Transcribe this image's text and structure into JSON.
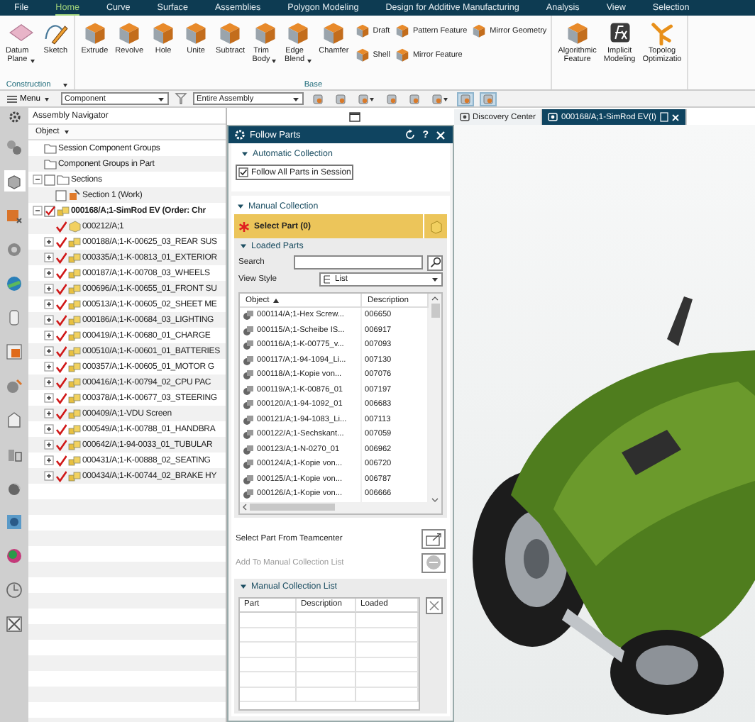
{
  "menu_bar": [
    {
      "label": "File",
      "selected": false
    },
    {
      "label": "Home",
      "selected": true
    },
    {
      "label": "Curve",
      "selected": false
    },
    {
      "label": "Surface",
      "selected": false
    },
    {
      "label": "Assemblies",
      "selected": false
    },
    {
      "label": "Polygon Modeling",
      "selected": false
    },
    {
      "label": "Design for Additive Manufacturing",
      "selected": false
    },
    {
      "label": "Analysis",
      "selected": false
    },
    {
      "label": "View",
      "selected": false
    },
    {
      "label": "Selection",
      "selected": false
    }
  ],
  "ribbon": {
    "groups": [
      {
        "label": "Construction",
        "has_menu": true,
        "items": [
          {
            "kind": "button",
            "label": "Datum\nPlane",
            "dropdown": true
          },
          {
            "kind": "button",
            "label": "Sketch",
            "dropdown": false
          }
        ]
      },
      {
        "label": "Base",
        "has_menu": false,
        "items": [
          {
            "kind": "button",
            "label": "Extrude",
            "dropdown": false
          },
          {
            "kind": "button",
            "label": "Revolve",
            "dropdown": false
          },
          {
            "kind": "button",
            "label": "Hole",
            "dropdown": false
          },
          {
            "kind": "button",
            "label": "Unite",
            "dropdown": false
          },
          {
            "kind": "button",
            "label": "Subtract",
            "dropdown": false
          },
          {
            "kind": "button",
            "label": "Trim\nBody",
            "dropdown": true
          },
          {
            "kind": "button",
            "label": "Edge\nBlend",
            "dropdown": true
          },
          {
            "kind": "button",
            "label": "Chamfer",
            "dropdown": false
          },
          {
            "kind": "stack",
            "items": [
              {
                "label": "Draft"
              },
              {
                "label": "Shell"
              }
            ]
          },
          {
            "kind": "stack",
            "items": [
              {
                "label": "Pattern Feature"
              },
              {
                "label": "Mirror Feature"
              }
            ]
          },
          {
            "kind": "stack",
            "items": [
              {
                "label": "Mirror Geometry"
              }
            ]
          }
        ]
      },
      {
        "has_menu": false,
        "items": [
          {
            "kind": "button",
            "label": "Algorithmic\nFeature",
            "dropdown": false
          },
          {
            "kind": "button",
            "label": "Implicit\nModeling",
            "dropdown": false
          },
          {
            "kind": "button",
            "label": "Topolog\nOptimizatio",
            "dropdown": false
          }
        ]
      }
    ]
  },
  "toolbar": {
    "menu": "Menu",
    "selection_filter": "Component",
    "scope": "Entire Assembly",
    "tools": [
      {
        "pressed": false,
        "dropdown": false
      },
      {
        "pressed": false,
        "dropdown": false
      },
      {
        "pressed": false,
        "dropdown": true
      },
      {
        "pressed": false,
        "dropdown": false
      },
      {
        "pressed": false,
        "dropdown": false
      },
      {
        "pressed": false,
        "dropdown": true
      },
      {
        "pressed": true,
        "dropdown": false
      },
      {
        "pressed": true,
        "dropdown": false
      }
    ]
  },
  "side_strip": [
    {
      "selected": false
    },
    {
      "selected": true
    },
    {
      "selected": false
    },
    {
      "selected": false
    },
    {
      "selected": false
    },
    {
      "selected": false
    },
    {
      "selected": false
    },
    {
      "selected": false
    },
    {
      "selected": false
    },
    {
      "selected": false
    },
    {
      "selected": false
    },
    {
      "selected": false
    },
    {
      "selected": false
    },
    {
      "selected": false
    },
    {
      "selected": false
    }
  ],
  "navigator": {
    "title": "Assembly Navigator",
    "column": "Object",
    "tree": [
      {
        "kind": "folder",
        "label": "Session Component Groups"
      },
      {
        "kind": "folder",
        "label": "Component Groups in Part"
      },
      {
        "kind": "folder",
        "label": "Sections",
        "expanded": true,
        "checked": false,
        "children": [
          {
            "kind": "section",
            "label": "Section 1 (Work)",
            "checked": false
          }
        ]
      },
      {
        "kind": "root",
        "label": "000168/A;1-SimRod EV (Order: Chr",
        "expanded": true,
        "checked": true,
        "children": [
          {
            "kind": "part",
            "label": "000212/A;1",
            "checked": true
          },
          {
            "kind": "assembly",
            "label": "000188/A;1-K-00625_03_REAR SUS",
            "expanded": false,
            "checked": true
          },
          {
            "kind": "assembly",
            "label": "000335/A;1-K-00813_01_EXTERIOR",
            "expanded": false,
            "checked": true
          },
          {
            "kind": "assembly",
            "label": "000187/A;1-K-00708_03_WHEELS",
            "expanded": false,
            "checked": true
          },
          {
            "kind": "assembly",
            "label": "000696/A;1-K-00655_01_FRONT SU",
            "expanded": false,
            "checked": true
          },
          {
            "kind": "assembly",
            "label": "000513/A;1-K-00605_02_SHEET ME",
            "expanded": false,
            "checked": true
          },
          {
            "kind": "assembly",
            "label": "000186/A;1-K-00684_03_LIGHTING",
            "expanded": false,
            "checked": true
          },
          {
            "kind": "assembly",
            "label": "000419/A;1-K-00680_01_CHARGE",
            "expanded": false,
            "checked": true
          },
          {
            "kind": "assembly",
            "label": "000510/A;1-K-00601_01_BATTERIES",
            "expanded": false,
            "checked": true
          },
          {
            "kind": "assembly",
            "label": "000357/A;1-K-00605_01_MOTOR G",
            "expanded": false,
            "checked": true
          },
          {
            "kind": "assembly",
            "label": "000416/A;1-K-00794_02_CPU PAC",
            "expanded": false,
            "checked": true
          },
          {
            "kind": "assembly",
            "label": "000378/A;1-K-00677_03_STEERING",
            "expanded": false,
            "checked": true
          },
          {
            "kind": "assembly",
            "label": "000409/A;1-VDU Screen",
            "expanded": false,
            "checked": true
          },
          {
            "kind": "assembly",
            "label": "000549/A;1-K-00788_01_HANDBRA",
            "expanded": false,
            "checked": true
          },
          {
            "kind": "assembly",
            "label": "000642/A;1-94-0033_01_TUBULAR",
            "expanded": false,
            "checked": true
          },
          {
            "kind": "assembly",
            "label": "000431/A;1-K-00888_02_SEATING",
            "expanded": false,
            "checked": true
          },
          {
            "kind": "assembly",
            "label": "000434/A;1-K-00744_02_BRAKE HY",
            "expanded": false,
            "checked": true
          }
        ]
      }
    ]
  },
  "follow_parts": {
    "title": "Follow Parts",
    "help": "?",
    "automatic_collection": {
      "label": "Automatic Collection",
      "expanded": true,
      "follow_all": {
        "label": "Follow All Parts in Session",
        "checked": true
      }
    },
    "manual_collection": {
      "label": "Manual Collection",
      "expanded": true,
      "select_part": "Select Part (0)",
      "loaded_parts": {
        "label": "Loaded Parts",
        "expanded": true,
        "search_label": "Search",
        "view_style_label": "View Style",
        "view_style": "List",
        "columns": [
          {
            "label": "Object",
            "sorted": true
          },
          {
            "label": "Description",
            "sorted": false
          }
        ],
        "rows": [
          {
            "object": "000114/A;1-Hex Screw...",
            "description": "006650"
          },
          {
            "object": "000115/A;1-Scheibe IS...",
            "description": "006917"
          },
          {
            "object": "000116/A;1-K-00775_v...",
            "description": "007093"
          },
          {
            "object": "000117/A;1-94-1094_Li...",
            "description": "007130"
          },
          {
            "object": "000118/A;1-Kopie von...",
            "description": "007076"
          },
          {
            "object": "000119/A;1-K-00876_01",
            "description": "007197"
          },
          {
            "object": "000120/A;1-94-1092_01",
            "description": "006683"
          },
          {
            "object": "000121/A;1-94-1083_Li...",
            "description": "007113"
          },
          {
            "object": "000122/A;1-Sechskant...",
            "description": "007059"
          },
          {
            "object": "000123/A;1-N-0270_01",
            "description": "006962"
          },
          {
            "object": "000124/A;1-Kopie von...",
            "description": "006720"
          },
          {
            "object": "000125/A;1-Kopie von...",
            "description": "006787"
          },
          {
            "object": "000126/A;1-Kopie von...",
            "description": "006666"
          }
        ]
      },
      "select_from_teamcenter": "Select Part From Teamcenter",
      "add_to_list": {
        "label": "Add To Manual Collection List",
        "disabled": true
      },
      "manual_list": {
        "label": "Manual Collection List",
        "expanded": true,
        "columns": [
          "Part",
          "Description",
          "Loaded"
        ]
      }
    }
  },
  "viewport": {
    "tabs": [
      {
        "label": "Discovery Center",
        "selected": false,
        "closable": false
      },
      {
        "label": "000168/A;1-SimRod EV(I)",
        "selected": true,
        "closable": true
      }
    ]
  }
}
